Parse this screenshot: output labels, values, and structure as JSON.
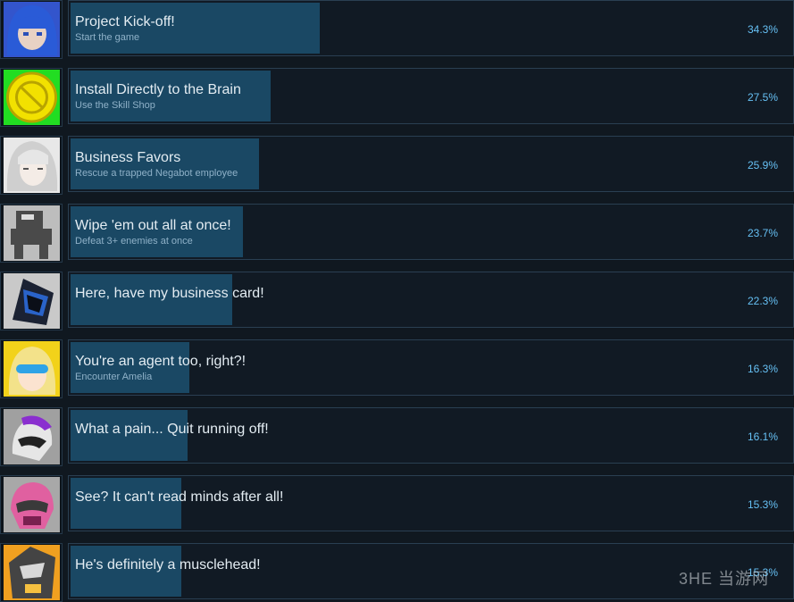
{
  "achievements": [
    {
      "title": "Project Kick-off!",
      "description": "Start the game",
      "percent_label": "34.3%",
      "percent": 34.3,
      "icon": "blue-hair-girl-icon",
      "colors": {
        "bg": "#3355cc",
        "main": "#2a5bd7",
        "accent": "#e8d2c4"
      }
    },
    {
      "title": "Install Directly to the Brain",
      "description": "Use the Skill Shop",
      "percent_label": "27.5%",
      "percent": 27.5,
      "icon": "gold-coin-icon",
      "colors": {
        "bg": "#22dd22",
        "main": "#f2e100",
        "accent": "#b8a400"
      }
    },
    {
      "title": "Business Favors",
      "description": "Rescue a trapped Negabot employee",
      "percent_label": "25.9%",
      "percent": 25.9,
      "icon": "white-hair-girl-icon",
      "colors": {
        "bg": "#e8e8e8",
        "main": "#cfcfcf",
        "accent": "#555555"
      }
    },
    {
      "title": "Wipe 'em out all at once!",
      "description": "Defeat 3+ enemies at once",
      "percent_label": "23.7%",
      "percent": 23.7,
      "icon": "robot-icon",
      "colors": {
        "bg": "#bdbdbd",
        "main": "#4a4a4a",
        "accent": "#dddddd"
      }
    },
    {
      "title": "Here, have my business card!",
      "description": "",
      "percent_label": "22.3%",
      "percent": 22.3,
      "icon": "armored-helmet-icon",
      "colors": {
        "bg": "#c9c9c9",
        "main": "#1b2233",
        "accent": "#2a63c9"
      }
    },
    {
      "title": "You're an agent too, right?!",
      "description": "Encounter Amelia",
      "percent_label": "16.3%",
      "percent": 16.3,
      "icon": "blonde-girl-icon",
      "colors": {
        "bg": "#f2d21a",
        "main": "#f3e28a",
        "accent": "#2fa3e6"
      }
    },
    {
      "title": "What a pain... Quit running off!",
      "description": "",
      "percent_label": "16.1%",
      "percent": 16.1,
      "icon": "purple-helmet-icon",
      "colors": {
        "bg": "#a0a0a0",
        "main": "#8a2fcf",
        "accent": "#e6e6e6"
      }
    },
    {
      "title": "See? It can't read minds after all!",
      "description": "",
      "percent_label": "15.3%",
      "percent": 15.3,
      "icon": "pink-helmet-icon",
      "colors": {
        "bg": "#a8a8a8",
        "main": "#e060a0",
        "accent": "#3a3a3a"
      }
    },
    {
      "title": "He's definitely a musclehead!",
      "description": "",
      "percent_label": "15.3%",
      "percent": 15.3,
      "icon": "orange-mech-icon",
      "colors": {
        "bg": "#f0a020",
        "main": "#444444",
        "accent": "#f5c040"
      }
    }
  ],
  "watermark": "3HE 当游网"
}
